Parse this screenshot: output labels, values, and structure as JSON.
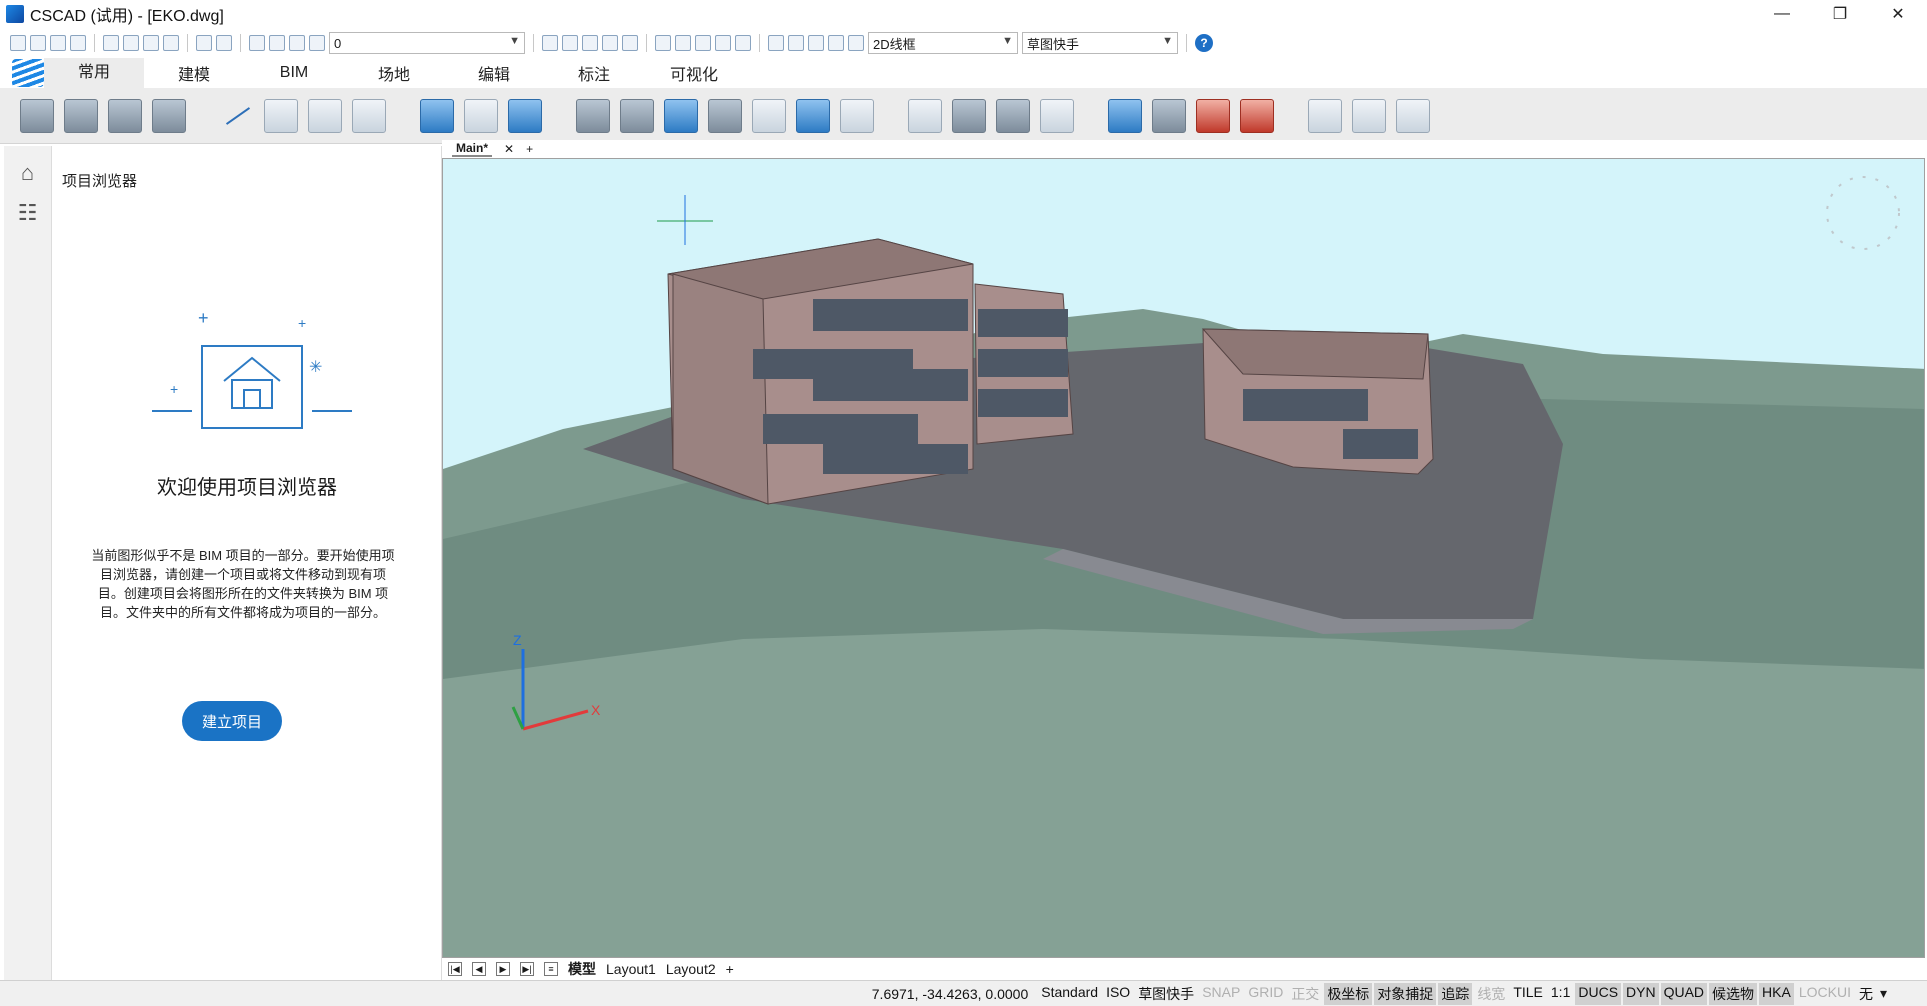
{
  "window": {
    "title": "CSCAD (试用) - [EKO.dwg]",
    "controls": [
      "—",
      "❐",
      "✕"
    ]
  },
  "quick_access": {
    "layer_value": "0",
    "visual_style": "2D线框",
    "workspace": "草图快手"
  },
  "ribbon": {
    "tabs": [
      "常用",
      "建模",
      "BIM",
      "场地",
      "编辑",
      "标注",
      "可视化"
    ],
    "active_tab": 0
  },
  "project_browser": {
    "title": "项目浏览器",
    "heading": "欢迎使用项目浏览器",
    "description": "当前图形似乎不是 BIM 项目的一部分。要开始使用项目浏览器，请创建一个项目或将文件移动到现有项目。创建项目会将图形所在的文件夹转换为 BIM 项目。文件夹中的所有文件都将成为项目的一部分。",
    "create_button": "建立项目"
  },
  "document_tabs": {
    "active": "Main*",
    "close_glyph": "✕",
    "add_glyph": "+"
  },
  "viewport": {
    "axis_x": "X",
    "axis_z": "Z",
    "sky_color": "#d4f4fa",
    "terrain_color": "#7d9a8e",
    "building_color": "#a88e8c"
  },
  "layout_tabs": {
    "items": [
      "模型",
      "Layout1",
      "Layout2",
      "+"
    ],
    "active": 0
  },
  "status_bar": {
    "coords": "7.6971, -34.4263, 0.0000",
    "items": [
      {
        "label": "Standard",
        "state": "normal"
      },
      {
        "label": "ISO",
        "state": "normal"
      },
      {
        "label": "草图快手",
        "state": "normal"
      },
      {
        "label": "SNAP",
        "state": "off"
      },
      {
        "label": "GRID",
        "state": "off"
      },
      {
        "label": "正交",
        "state": "off"
      },
      {
        "label": "极坐标",
        "state": "on"
      },
      {
        "label": "对象捕捉",
        "state": "on"
      },
      {
        "label": "追踪",
        "state": "on"
      },
      {
        "label": "线宽",
        "state": "off"
      },
      {
        "label": "TILE",
        "state": "normal"
      },
      {
        "label": "1:1",
        "state": "normal"
      },
      {
        "label": "DUCS",
        "state": "on"
      },
      {
        "label": "DYN",
        "state": "on"
      },
      {
        "label": "QUAD",
        "state": "on"
      },
      {
        "label": "候选物",
        "state": "on"
      },
      {
        "label": "HKA",
        "state": "on"
      },
      {
        "label": "LOCKUI",
        "state": "off"
      },
      {
        "label": "无",
        "state": "normal"
      }
    ]
  }
}
